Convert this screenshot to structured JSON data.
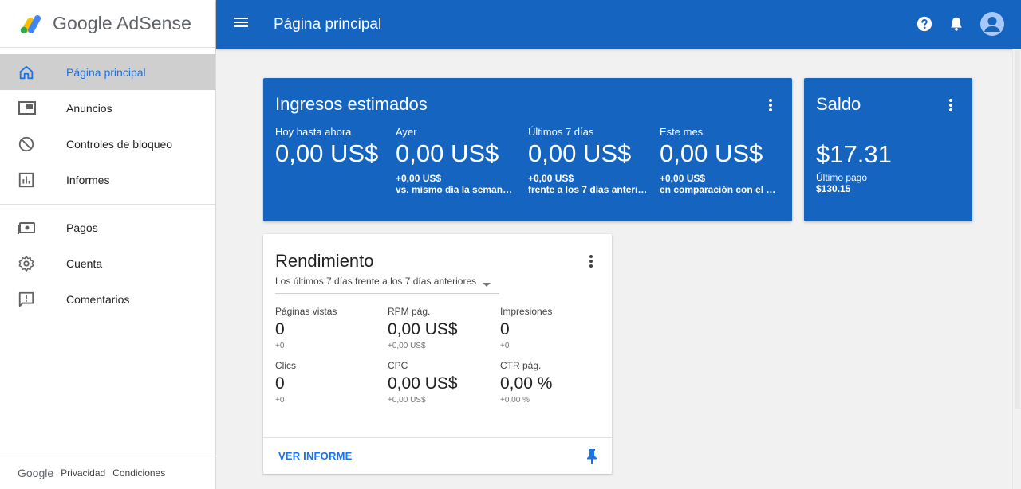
{
  "app": {
    "logo_text": "Google AdSense"
  },
  "topbar": {
    "title": "Página principal"
  },
  "sidebar": {
    "items": [
      {
        "label": "Página principal",
        "icon": "home-icon",
        "active": true
      },
      {
        "label": "Anuncios",
        "icon": "ads-icon"
      },
      {
        "label": "Controles de bloqueo",
        "icon": "block-icon"
      },
      {
        "label": "Informes",
        "icon": "reports-icon"
      },
      {
        "label": "Pagos",
        "icon": "payments-icon"
      },
      {
        "label": "Cuenta",
        "icon": "gear-icon"
      },
      {
        "label": "Comentarios",
        "icon": "feedback-icon"
      }
    ],
    "footer": {
      "google": "Google",
      "privacy": "Privacidad",
      "terms": "Condiciones"
    }
  },
  "earnings": {
    "title": "Ingresos estimados",
    "metrics": [
      {
        "label": "Hoy hasta ahora",
        "value": "0,00 US$",
        "delta": "",
        "comparison": ""
      },
      {
        "label": "Ayer",
        "value": "0,00 US$",
        "delta": "+0,00 US$",
        "comparison": "vs. mismo día la semana ..."
      },
      {
        "label": "Últimos 7 días",
        "value": "0,00 US$",
        "delta": "+0,00 US$",
        "comparison": "frente a los 7 días anterio..."
      },
      {
        "label": "Este mes",
        "value": "0,00 US$",
        "delta": "+0,00 US$",
        "comparison": "en comparación con el m..."
      }
    ]
  },
  "balance": {
    "title": "Saldo",
    "value": "$17.31",
    "last_payment_label": "Último pago",
    "last_payment_value": "$130.15"
  },
  "performance": {
    "title": "Rendimiento",
    "range": "Los últimos 7 días frente a los 7 días anteriores",
    "metrics": [
      {
        "label": "Páginas vistas",
        "value": "0",
        "delta": "+0"
      },
      {
        "label": "RPM pág.",
        "value": "0,00 US$",
        "delta": "+0,00 US$"
      },
      {
        "label": "Impresiones",
        "value": "0",
        "delta": "+0"
      },
      {
        "label": "Clics",
        "value": "0",
        "delta": "+0"
      },
      {
        "label": "CPC",
        "value": "0,00 US$",
        "delta": "+0,00 US$"
      },
      {
        "label": "CTR pág.",
        "value": "0,00 %",
        "delta": "+0,00 %"
      }
    ],
    "report_link": "VER INFORME"
  },
  "colors": {
    "primary": "#1565c0",
    "accent": "#1a73e8",
    "background": "#f1f1f1",
    "active_nav": "#cfcfcf"
  }
}
